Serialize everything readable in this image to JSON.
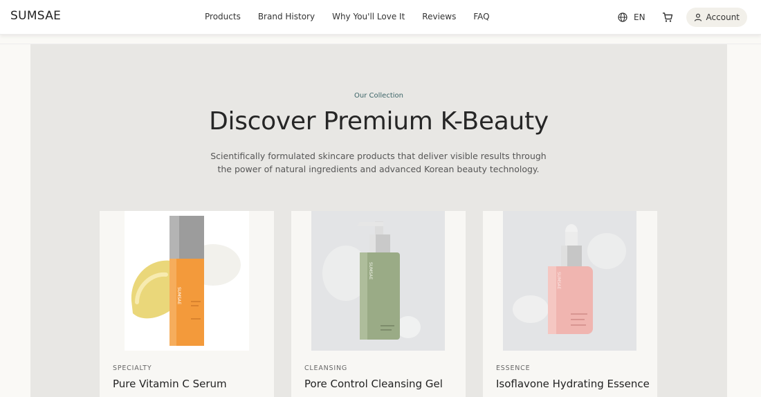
{
  "brand": "SUMSAE",
  "nav": [
    "Products",
    "Brand History",
    "Why You'll Love It",
    "Reviews",
    "FAQ"
  ],
  "header": {
    "language": "EN",
    "account_label": "Account"
  },
  "section": {
    "eyebrow": "Our Collection",
    "title": "Discover Premium K-Beauty",
    "description": "Scientifically formulated skincare products that deliver visible results through the power of natural ingredients and advanced Korean beauty technology."
  },
  "products": [
    {
      "category": "SPECIALTY",
      "name": "Pure Vitamin C Serum",
      "bottle_color": "#f39a3b"
    },
    {
      "category": "CLEANSING",
      "name": "Pore Control Cleansing Gel",
      "bottle_color": "#9aab86"
    },
    {
      "category": "ESSENCE",
      "name": "Isoflavone Hydrating Essence",
      "bottle_color": "#f0b5b0"
    }
  ],
  "icons": [
    "globe-icon",
    "cart-icon",
    "user-icon"
  ],
  "colors": {
    "panel": "#e8e7e4",
    "accent": "#3b6467",
    "card": "#f8f7f4"
  }
}
